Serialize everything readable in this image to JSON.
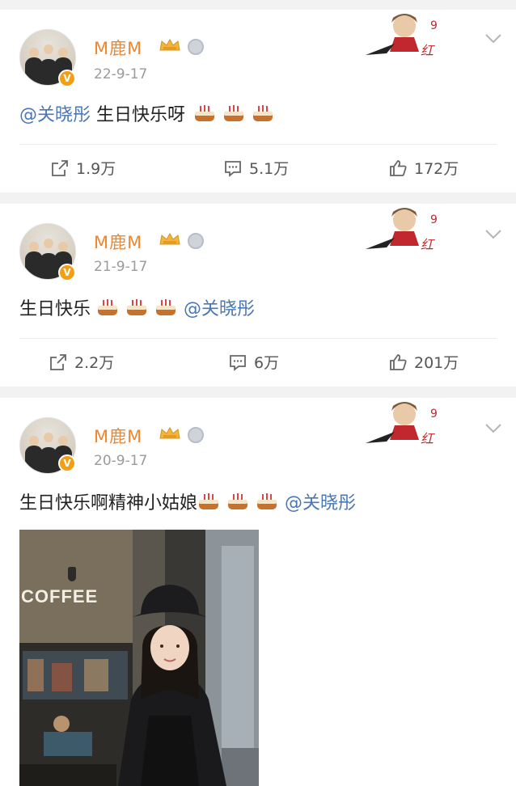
{
  "posts": [
    {
      "username": "M鹿M",
      "date": "22-9-17",
      "text": [
        "@关晓彤",
        " 生日快乐呀"
      ],
      "cakes": 3,
      "repost": "1.9万",
      "comment": "5.1万",
      "like": "172万"
    },
    {
      "username": "M鹿M",
      "date": "21-9-17",
      "text": [
        "生日快乐 ",
        "@关晓彤"
      ],
      "cakes": 3,
      "repost": "2.2万",
      "comment": "6万",
      "like": "201万"
    },
    {
      "username": "M鹿M",
      "date": "20-9-17",
      "text": [
        "生日快乐啊精神小姑娘",
        "@关晓彤"
      ],
      "cakes": 3,
      "photo_sign": "COFFEE"
    }
  ],
  "icons": {
    "verified": "verified-badge-icon",
    "member": "crown-icon",
    "medal": "medal-icon",
    "more": "chevron-down-icon",
    "repost": "repost-icon",
    "comment": "comment-icon",
    "like": "like-icon",
    "cake": "cake-emoji-icon"
  },
  "colors": {
    "username": "#f0862f",
    "mention": "#4a77b5",
    "date": "#9b9b9b",
    "background": "#f2f2f2",
    "verified": "#f49f13"
  }
}
